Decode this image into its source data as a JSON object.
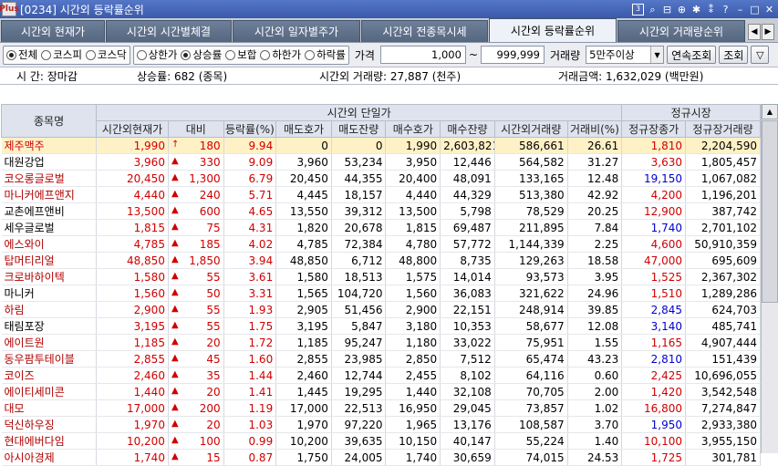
{
  "window": {
    "logo": "Plus",
    "title": "[0234] 시간외 등락률순위"
  },
  "tabs": [
    {
      "label": "시간외 현재가",
      "active": false
    },
    {
      "label": "시간외 시간별체결",
      "active": false
    },
    {
      "label": "시간외 일자별주가",
      "active": false
    },
    {
      "label": "시간외 전종목시세",
      "active": false
    },
    {
      "label": "시간외 등락률순위",
      "active": true
    },
    {
      "label": "시간외 거래량순위",
      "active": false
    }
  ],
  "filters": {
    "market": [
      "전체",
      "코스피",
      "코스닥"
    ],
    "market_selected": "전체",
    "direction": [
      "상한가",
      "상승률",
      "보합",
      "하한가",
      "하락률"
    ],
    "direction_selected": "상승률",
    "price_label": "가격",
    "price_from": "1,000",
    "price_tilde": "~",
    "price_to": "999,999",
    "volume_label": "거래량",
    "volume_selected": "5만주이상",
    "continuous_btn": "연속조회",
    "query_btn": "조회"
  },
  "summary": {
    "time": "시    간: 장마감",
    "rise_count": "상승률:      682 (종목)",
    "volume": "시간외 거래량:      27,887 (천주)",
    "amount": "거래금액:       1,632,029 (백만원)"
  },
  "table": {
    "group_headers": {
      "name": "종목명",
      "single": "시간외 단일가",
      "regular": "정규시장"
    },
    "columns": [
      "시간외현재가",
      "대비",
      "등락률(%)",
      "매도호가",
      "매도잔량",
      "매수호가",
      "매수잔량",
      "시간외거래량",
      "거래비(%)",
      "정규장종가",
      "정규장거래량"
    ],
    "rows": [
      {
        "name": "제주맥주",
        "price": "1,990",
        "arrow": "↑",
        "change": "180",
        "rate": "9.94",
        "ask": "0",
        "ask_qty": "0",
        "bid": "1,990",
        "bid_qty": "2,603,821",
        "vol": "586,661",
        "vol_ratio": "26.61",
        "close": "1,810",
        "close_color": "up",
        "reg_vol": "2,204,590"
      },
      {
        "name": "대원강업",
        "price": "3,960",
        "arrow": "▲",
        "change": "330",
        "rate": "9.09",
        "ask": "3,960",
        "ask_qty": "53,234",
        "bid": "3,950",
        "bid_qty": "12,446",
        "vol": "564,582",
        "vol_ratio": "31.27",
        "close": "3,630",
        "close_color": "up",
        "reg_vol": "1,805,457"
      },
      {
        "name": "코오롱글로벌",
        "price": "20,450",
        "arrow": "▲",
        "change": "1,300",
        "rate": "6.79",
        "ask": "20,450",
        "ask_qty": "44,355",
        "bid": "20,400",
        "bid_qty": "48,091",
        "vol": "133,165",
        "vol_ratio": "12.48",
        "close": "19,150",
        "close_color": "dn",
        "reg_vol": "1,067,082"
      },
      {
        "name": "마니커에프앤지",
        "price": "4,440",
        "arrow": "▲",
        "change": "240",
        "rate": "5.71",
        "ask": "4,445",
        "ask_qty": "18,157",
        "bid": "4,440",
        "bid_qty": "44,329",
        "vol": "513,380",
        "vol_ratio": "42.92",
        "close": "4,200",
        "close_color": "up",
        "reg_vol": "1,196,201"
      },
      {
        "name": "교촌에프앤비",
        "price": "13,500",
        "arrow": "▲",
        "change": "600",
        "rate": "4.65",
        "ask": "13,550",
        "ask_qty": "39,312",
        "bid": "13,500",
        "bid_qty": "5,798",
        "vol": "78,529",
        "vol_ratio": "20.25",
        "close": "12,900",
        "close_color": "up",
        "reg_vol": "387,742"
      },
      {
        "name": "세우글로벌",
        "price": "1,815",
        "arrow": "▲",
        "change": "75",
        "rate": "4.31",
        "ask": "1,820",
        "ask_qty": "20,678",
        "bid": "1,815",
        "bid_qty": "69,487",
        "vol": "211,895",
        "vol_ratio": "7.84",
        "close": "1,740",
        "close_color": "dn",
        "reg_vol": "2,701,102"
      },
      {
        "name": "에스와이",
        "price": "4,785",
        "arrow": "▲",
        "change": "185",
        "rate": "4.02",
        "ask": "4,785",
        "ask_qty": "72,384",
        "bid": "4,780",
        "bid_qty": "57,772",
        "vol": "1,144,339",
        "vol_ratio": "2.25",
        "close": "4,600",
        "close_color": "up",
        "reg_vol": "50,910,359"
      },
      {
        "name": "탑머티리얼",
        "price": "48,850",
        "arrow": "▲",
        "change": "1,850",
        "rate": "3.94",
        "ask": "48,850",
        "ask_qty": "6,712",
        "bid": "48,800",
        "bid_qty": "8,735",
        "vol": "129,263",
        "vol_ratio": "18.58",
        "close": "47,000",
        "close_color": "up",
        "reg_vol": "695,609"
      },
      {
        "name": "크로바하이텍",
        "price": "1,580",
        "arrow": "▲",
        "change": "55",
        "rate": "3.61",
        "ask": "1,580",
        "ask_qty": "18,513",
        "bid": "1,575",
        "bid_qty": "14,014",
        "vol": "93,573",
        "vol_ratio": "3.95",
        "close": "1,525",
        "close_color": "up",
        "reg_vol": "2,367,302"
      },
      {
        "name": "마니커",
        "price": "1,560",
        "arrow": "▲",
        "change": "50",
        "rate": "3.31",
        "ask": "1,565",
        "ask_qty": "104,720",
        "bid": "1,560",
        "bid_qty": "36,083",
        "vol": "321,622",
        "vol_ratio": "24.96",
        "close": "1,510",
        "close_color": "up",
        "reg_vol": "1,289,286"
      },
      {
        "name": "하림",
        "price": "2,900",
        "arrow": "▲",
        "change": "55",
        "rate": "1.93",
        "ask": "2,905",
        "ask_qty": "51,456",
        "bid": "2,900",
        "bid_qty": "22,151",
        "vol": "248,914",
        "vol_ratio": "39.85",
        "close": "2,845",
        "close_color": "dn",
        "reg_vol": "624,703"
      },
      {
        "name": "태림포장",
        "price": "3,195",
        "arrow": "▲",
        "change": "55",
        "rate": "1.75",
        "ask": "3,195",
        "ask_qty": "5,847",
        "bid": "3,180",
        "bid_qty": "10,353",
        "vol": "58,677",
        "vol_ratio": "12.08",
        "close": "3,140",
        "close_color": "dn",
        "reg_vol": "485,741"
      },
      {
        "name": "에이트원",
        "price": "1,185",
        "arrow": "▲",
        "change": "20",
        "rate": "1.72",
        "ask": "1,185",
        "ask_qty": "95,247",
        "bid": "1,180",
        "bid_qty": "33,022",
        "vol": "75,951",
        "vol_ratio": "1.55",
        "close": "1,165",
        "close_color": "up",
        "reg_vol": "4,907,444"
      },
      {
        "name": "동우팜투테이블",
        "price": "2,855",
        "arrow": "▲",
        "change": "45",
        "rate": "1.60",
        "ask": "2,855",
        "ask_qty": "23,985",
        "bid": "2,850",
        "bid_qty": "7,512",
        "vol": "65,474",
        "vol_ratio": "43.23",
        "close": "2,810",
        "close_color": "dn",
        "reg_vol": "151,439"
      },
      {
        "name": "코이즈",
        "price": "2,460",
        "arrow": "▲",
        "change": "35",
        "rate": "1.44",
        "ask": "2,460",
        "ask_qty": "12,744",
        "bid": "2,455",
        "bid_qty": "8,102",
        "vol": "64,116",
        "vol_ratio": "0.60",
        "close": "2,425",
        "close_color": "up",
        "reg_vol": "10,696,055"
      },
      {
        "name": "에이티세미콘",
        "price": "1,440",
        "arrow": "▲",
        "change": "20",
        "rate": "1.41",
        "ask": "1,445",
        "ask_qty": "19,295",
        "bid": "1,440",
        "bid_qty": "32,108",
        "vol": "70,705",
        "vol_ratio": "2.00",
        "close": "1,420",
        "close_color": "up",
        "reg_vol": "3,542,548"
      },
      {
        "name": "대모",
        "price": "17,000",
        "arrow": "▲",
        "change": "200",
        "rate": "1.19",
        "ask": "17,000",
        "ask_qty": "22,513",
        "bid": "16,950",
        "bid_qty": "29,045",
        "vol": "73,857",
        "vol_ratio": "1.02",
        "close": "16,800",
        "close_color": "up",
        "reg_vol": "7,274,847"
      },
      {
        "name": "덕신하우징",
        "price": "1,970",
        "arrow": "▲",
        "change": "20",
        "rate": "1.03",
        "ask": "1,970",
        "ask_qty": "97,220",
        "bid": "1,965",
        "bid_qty": "13,176",
        "vol": "108,587",
        "vol_ratio": "3.70",
        "close": "1,950",
        "close_color": "dn",
        "reg_vol": "2,933,380"
      },
      {
        "name": "현대에버다임",
        "price": "10,200",
        "arrow": "▲",
        "change": "100",
        "rate": "0.99",
        "ask": "10,200",
        "ask_qty": "39,635",
        "bid": "10,150",
        "bid_qty": "40,147",
        "vol": "55,224",
        "vol_ratio": "1.40",
        "close": "10,100",
        "close_color": "up",
        "reg_vol": "3,955,150"
      },
      {
        "name": "아시아경제",
        "price": "1,740",
        "arrow": "▲",
        "change": "15",
        "rate": "0.87",
        "ask": "1,750",
        "ask_qty": "24,005",
        "bid": "1,740",
        "bid_qty": "30,659",
        "vol": "74,015",
        "vol_ratio": "24.53",
        "close": "1,725",
        "close_color": "up",
        "reg_vol": "301,781"
      }
    ]
  },
  "colors": {
    "up": "#d00000",
    "down": "#0000d0",
    "highlight_row": "#fff1c6",
    "header_bg": "#dfe3ee"
  }
}
